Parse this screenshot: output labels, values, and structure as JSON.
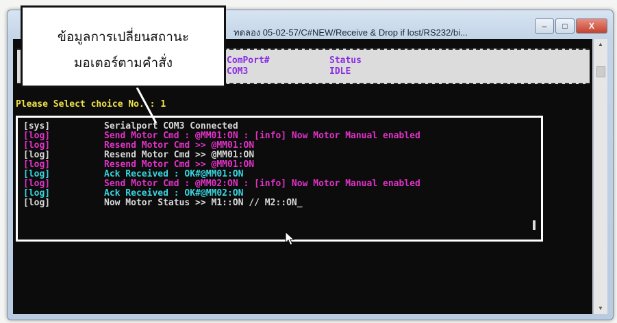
{
  "window": {
    "title": "ทดลอง 05-02-57/C#NEW/Receive & Drop if lost/RS232/bi...",
    "min_label": "–",
    "max_label": "□",
    "close_label": "X"
  },
  "status_box": {
    "comport_header": "ComPort#",
    "comport_value": "COM3",
    "status_header": "Status",
    "status_value": "IDLE"
  },
  "prompt": "Please Select choice No. : 1",
  "log_lines": [
    {
      "tag": "[sys]",
      "text": "Serialport COM3 Connected",
      "color": "#d8d8d8"
    },
    {
      "tag": "[log]",
      "text": "Send Motor Cmd : @MM01:ON : [info] Now Motor Manual enabled",
      "color": "#e232c8"
    },
    {
      "tag": "[log]",
      "text": "Resend Motor Cmd >> @MM01:ON",
      "color": "#e232c8"
    },
    {
      "tag": "[log]",
      "text": "Resend Motor Cmd >> @MM01:ON",
      "color": "#d8d8d8"
    },
    {
      "tag": "[log]",
      "text": "Resend Motor Cmd >> @MM01:ON",
      "color": "#e232c8"
    },
    {
      "tag": "[log]",
      "text": "Ack Received : OK#@MM01:ON",
      "color": "#38d6e0"
    },
    {
      "tag": "[log]",
      "text": "Send Motor Cmd : @MM02:ON : [info] Now Motor Manual enabled",
      "color": "#e232c8"
    },
    {
      "tag": "[log]",
      "text": "Ack Received : OK#@MM02:ON",
      "color": "#38d6e0"
    },
    {
      "tag": "[log]",
      "text": "Now Motor Status >> M1::ON // M2::ON_",
      "color": "#d8d8d8"
    }
  ],
  "callout": {
    "line1": "ข้อมูลการเปลี่ยนสถานะ",
    "line2": "มอเตอร์ตามคำสั่ง"
  },
  "scrollbar": {
    "up_icon": "▲",
    "down_icon": "▼"
  }
}
